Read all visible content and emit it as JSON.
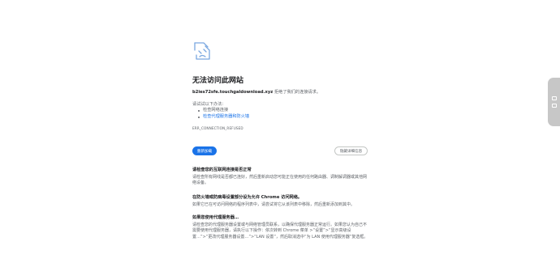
{
  "error": {
    "title": "无法访问此网站",
    "domain": "b2ies72sfe.touchgaldownload.xyz",
    "subtitle_rest": " 拒绝了我们的连接请求。",
    "try_label": "请试试以下办法：",
    "suggestions": [
      "检查网络连接",
      "检查代理服务器和防火墙"
    ],
    "code": "ERR_CONNECTION_REFUSED"
  },
  "buttons": {
    "reload": "重新加载",
    "details": "隐藏详细信息"
  },
  "details": [
    {
      "heading": "请检查您的互联网连接是否正常",
      "body": "请检查所有网线是否都已连好，然后重新启动您可能正在使用的任何路由器、调制解调器或其他网络设备。"
    },
    {
      "heading": "在防火墙或防病毒设置部分设为允许 Chrome 访问网络。",
      "body": "如果它已在可访问网络的程序列表中，请尝试将它从该列表中移除，然后重新添加到其中。"
    },
    {
      "heading": "如果您使用代理服务器…",
      "body": "请检查您的代理服务器设置或与网络管理员联系，以确保代理服务器正常运行。如果您认为自己不需要使用代理服务器，请执行以下操作：依次转到 Chrome 菜单 >“设置”>“显示高级设置…”>“更改代理服务器设置…”>“LAN 设置”，然后取消选中“为 LAN 使用代理服务器”复选框。"
    }
  ],
  "colors": {
    "accent": "#1a73e8",
    "text": "#202124",
    "muted": "#5f6368"
  },
  "icons": {
    "main": "sad-page-icon",
    "side_tab": [
      "window-icon",
      "window-icon"
    ]
  }
}
